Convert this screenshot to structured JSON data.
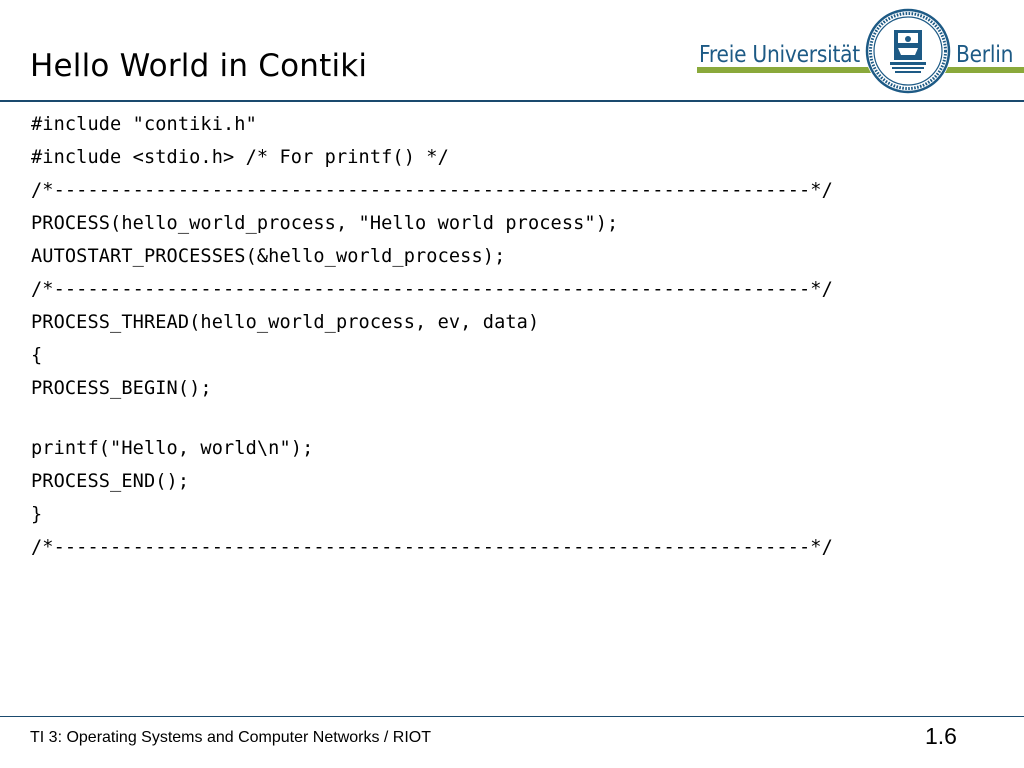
{
  "slide": {
    "title": "Hello World in Contiki",
    "logo": {
      "left_text": "Freie Universität",
      "right_text": "Berlin",
      "seal_text": "VERITAS · IUSTITIA · LIBERTAS · FREIE UNIVERSITÄT BERLIN"
    },
    "code_lines": [
      "#include \"contiki.h\"",
      "#include <stdio.h> /* For printf() */",
      "/*-------------------------------------------------------------------*/",
      "PROCESS(hello_world_process, \"Hello world process\");",
      "AUTOSTART_PROCESSES(&hello_world_process);",
      "/*-------------------------------------------------------------------*/",
      "PROCESS_THREAD(hello_world_process, ev, data)",
      "{",
      "PROCESS_BEGIN();",
      "printf(\"Hello, world\\n\");",
      "PROCESS_END();",
      "}",
      "/*-------------------------------------------------------------------*/"
    ],
    "footer_text": "TI 3: Operating Systems and Computer Networks / RIOT",
    "page_number": "1.6"
  },
  "colors": {
    "rule": "#1a4a6e",
    "logo_blue": "#1d5a85",
    "logo_green": "#8aa93b"
  }
}
